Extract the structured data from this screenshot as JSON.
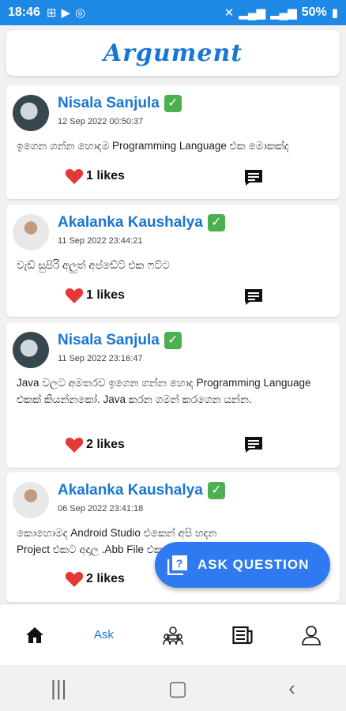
{
  "status_bar": {
    "time": "18:46",
    "battery": "50%"
  },
  "app": {
    "title": "Argument"
  },
  "posts": [
    {
      "author": "Nisala Sanjula",
      "verified_glyph": "✓",
      "timestamp": "12 Sep 2022 00:50:37",
      "text": "ඉගෙන ගන්න හොදම Programming Language එක මොකක්ද",
      "likes": "1 likes",
      "avatar": "avatar-1"
    },
    {
      "author": "Akalanka Kaushalya",
      "verified_glyph": "✓",
      "timestamp": "11 Sep 2022 23:44:21",
      "text": "වැඩ් සුපිරි අලුත් අප්ඩේට් එක ෆට්ට",
      "likes": "1 likes",
      "avatar": "avatar-2"
    },
    {
      "author": "Nisala Sanjula",
      "verified_glyph": "✓",
      "timestamp": "11 Sep 2022 23:16:47",
      "text": "Java වලට අමතරව ඉගෙන ගන්න හොද Programming Language එකක් කියන්නකෝ. Java කරන ගමන් කරගෙන යන්න.",
      "likes": "2 likes",
      "avatar": "avatar-1"
    },
    {
      "author": "Akalanka Kaushalya",
      "verified_glyph": "✓",
      "timestamp": "06 Sep 2022 23:41:18",
      "text": "කොහොමද Android Studio එකෙන් අපි හදන Project එකට අදාල .Abb File එක නිර්මාණ",
      "likes": "2 likes",
      "avatar": "avatar-2"
    }
  ],
  "fab": {
    "label": "ASK QUESTION"
  },
  "bottom_nav": {
    "items": [
      {
        "icon": "home-icon"
      },
      {
        "label": "Ask"
      },
      {
        "icon": "group-icon"
      },
      {
        "icon": "news-icon"
      },
      {
        "icon": "profile-icon"
      }
    ]
  },
  "colors": {
    "primary": "#1976d2",
    "status_bar": "#1e88e5",
    "fab": "#2f7af0",
    "heart": "#e53935",
    "verified": "#4caf50"
  }
}
